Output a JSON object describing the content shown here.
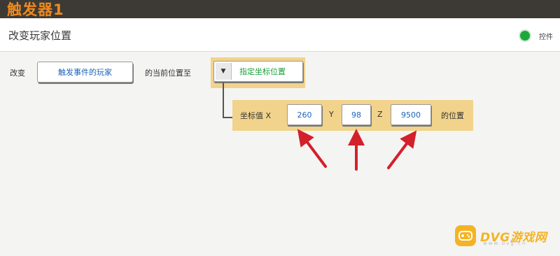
{
  "app": {
    "title": "触发器1"
  },
  "header": {
    "page_title": "改变玩家位置",
    "status_text": "控件"
  },
  "action": {
    "prefix": "改变",
    "player_button": "触发事件的玩家",
    "middle": "的当前位置至",
    "select_caret": "▼",
    "select_value": "指定坐标位置"
  },
  "coords": {
    "prefix": "坐标值 X",
    "x_value": "260",
    "y_label": "Y",
    "y_value": "98",
    "z_label": "Z",
    "z_value": "9500",
    "suffix": "的位置"
  },
  "watermark": {
    "brand": "DVG游戏网",
    "sub": "www.dvg.cn"
  },
  "colors": {
    "accent": "#f08a1c",
    "panel": "#f2d38b",
    "status_ok": "#1fa83a",
    "arrow": "#d3202a",
    "link": "#1d63b8"
  }
}
